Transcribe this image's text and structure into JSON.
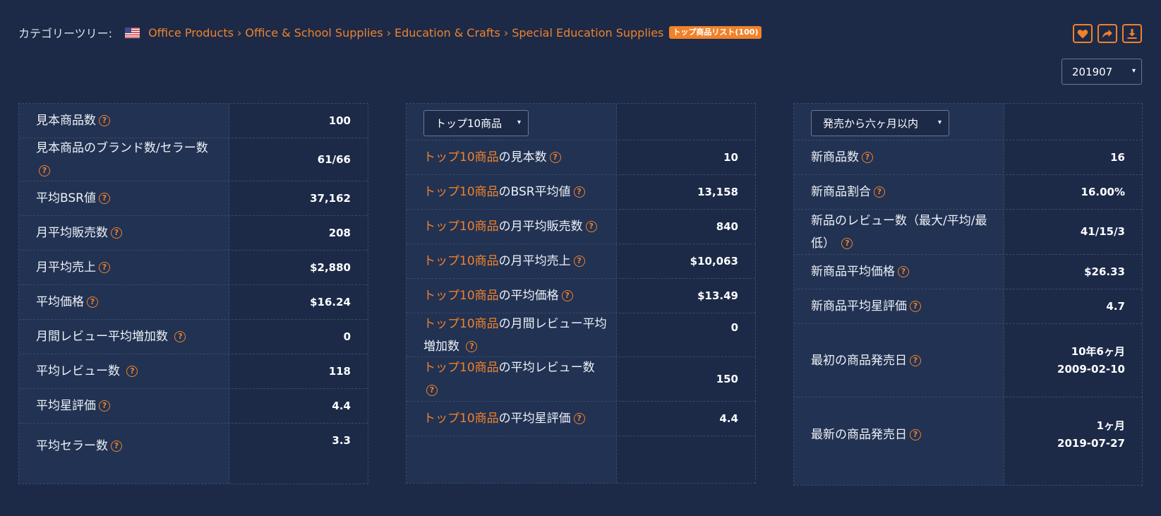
{
  "header": {
    "category_label": "カテゴリーツリー:",
    "breadcrumb": [
      "Office Products",
      "Office & School Supplies",
      "Education & Crafts",
      "Special Education Supplies"
    ],
    "separator": "›",
    "badge": "トップ商品リスト(100)"
  },
  "actions": {
    "favorite_icon": "heart-icon",
    "share_icon": "share-icon",
    "download_icon": "download-icon"
  },
  "month_select": {
    "value": "201907"
  },
  "panel_all": {
    "rows": [
      {
        "label": "見本商品数",
        "value": "100"
      },
      {
        "label": "見本商品のブランド数/セラー数",
        "value": "61/66"
      },
      {
        "label": "平均BSR値",
        "value": "37,162"
      },
      {
        "label": "月平均販売数",
        "value": "208"
      },
      {
        "label": "月平均売上",
        "value": "$2,880"
      },
      {
        "label": "平均価格",
        "value": "$16.24"
      },
      {
        "label": "月間レビュー平均増加数",
        "value": "0"
      },
      {
        "label": "平均レビュー数",
        "value": "118"
      },
      {
        "label": "平均星評価",
        "value": "4.4"
      },
      {
        "label": "平均セラー数",
        "value": "3.3"
      }
    ]
  },
  "panel_top": {
    "select_value": "トップ10商品",
    "prefix": "トップ10商品",
    "rows": [
      {
        "label": "の見本数",
        "value": "10"
      },
      {
        "label": "のBSR平均値",
        "value": "13,158"
      },
      {
        "label": "の月平均販売数",
        "value": "840"
      },
      {
        "label": "の月平均売上",
        "value": "$10,063"
      },
      {
        "label": "の平均価格",
        "value": "$13.49"
      },
      {
        "label": "の月間レビュー平均増加数",
        "value": "0"
      },
      {
        "label": "の平均レビュー数",
        "value": "150"
      },
      {
        "label": "の平均星評価",
        "value": "4.4"
      }
    ]
  },
  "panel_new": {
    "select_value": "発売から六ヶ月以内",
    "rows": [
      {
        "label": "新商品数",
        "value": "16"
      },
      {
        "label": "新商品割合",
        "value": "16.00%"
      },
      {
        "label": "新品のレビュー数（最大/平均/最低）",
        "value": "41/15/3"
      },
      {
        "label": "新商品平均価格",
        "value": "$26.33"
      },
      {
        "label": "新商品平均星評価",
        "value": "4.7"
      },
      {
        "label": "最初の商品発売日",
        "value": "10年6ヶ月",
        "value2": "2009-02-10"
      },
      {
        "label": "最新の商品発売日",
        "value": "1ヶ月",
        "value2": "2019-07-27"
      }
    ]
  },
  "help_glyph": "?",
  "caret_glyph": "▾"
}
